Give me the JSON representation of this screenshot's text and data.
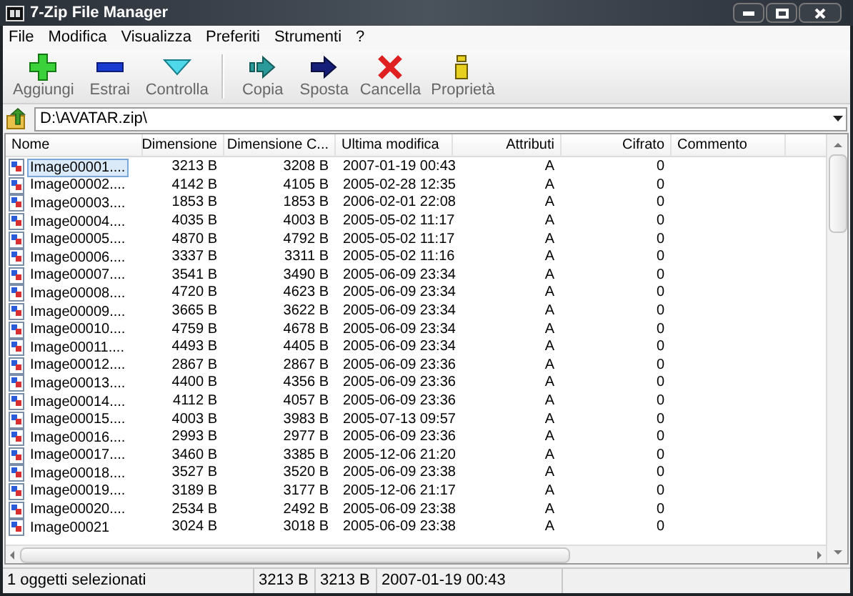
{
  "window": {
    "title": "7-Zip File Manager"
  },
  "menu": [
    "File",
    "Modifica",
    "Visualizza",
    "Preferiti",
    "Strumenti",
    "?"
  ],
  "toolbar": {
    "groups": [
      [
        {
          "label": "Aggiungi",
          "kind": "add"
        },
        {
          "label": "Estrai",
          "kind": "extract"
        },
        {
          "label": "Controlla",
          "kind": "test"
        }
      ],
      [
        {
          "label": "Copia",
          "kind": "copy"
        },
        {
          "label": "Sposta",
          "kind": "move"
        },
        {
          "label": "Cancella",
          "kind": "delete"
        },
        {
          "label": "Proprietà",
          "kind": "info"
        }
      ]
    ]
  },
  "address": {
    "value": "D:\\AVATAR.zip\\"
  },
  "table": {
    "columns": [
      "Nome",
      "Dimensione",
      "Dimensione C...",
      "Ultima modifica",
      "Attributi",
      "Cifrato",
      "Commento"
    ],
    "rows": [
      {
        "selected": true,
        "cells": [
          "Image00001....",
          "3213 B",
          "3208 B",
          "2007-01-19 00:43",
          "A",
          "0"
        ]
      },
      {
        "selected": false,
        "cells": [
          "Image00002....",
          "4142 B",
          "4105 B",
          "2005-02-28 12:35",
          "A",
          "0"
        ]
      },
      {
        "selected": false,
        "cells": [
          "Image00003....",
          "1853 B",
          "1853 B",
          "2006-02-01 22:08",
          "A",
          "0"
        ]
      },
      {
        "selected": false,
        "cells": [
          "Image00004....",
          "4035 B",
          "4003 B",
          "2005-05-02 11:17",
          "A",
          "0"
        ]
      },
      {
        "selected": false,
        "cells": [
          "Image00005....",
          "4870 B",
          "4792 B",
          "2005-05-02 11:17",
          "A",
          "0"
        ]
      },
      {
        "selected": false,
        "cells": [
          "Image00006....",
          "3337 B",
          "3311 B",
          "2005-05-02 11:16",
          "A",
          "0"
        ]
      },
      {
        "selected": false,
        "cells": [
          "Image00007....",
          "3541 B",
          "3490 B",
          "2005-06-09 23:34",
          "A",
          "0"
        ]
      },
      {
        "selected": false,
        "cells": [
          "Image00008....",
          "4720 B",
          "4623 B",
          "2005-06-09 23:34",
          "A",
          "0"
        ]
      },
      {
        "selected": false,
        "cells": [
          "Image00009....",
          "3665 B",
          "3622 B",
          "2005-06-09 23:34",
          "A",
          "0"
        ]
      },
      {
        "selected": false,
        "cells": [
          "Image00010....",
          "4759 B",
          "4678 B",
          "2005-06-09 23:34",
          "A",
          "0"
        ]
      },
      {
        "selected": false,
        "cells": [
          "Image00011....",
          "4493 B",
          "4405 B",
          "2005-06-09 23:34",
          "A",
          "0"
        ]
      },
      {
        "selected": false,
        "cells": [
          "Image00012....",
          "2867 B",
          "2867 B",
          "2005-06-09 23:36",
          "A",
          "0"
        ]
      },
      {
        "selected": false,
        "cells": [
          "Image00013....",
          "4400 B",
          "4356 B",
          "2005-06-09 23:36",
          "A",
          "0"
        ]
      },
      {
        "selected": false,
        "cells": [
          "Image00014....",
          "4112 B",
          "4057 B",
          "2005-06-09 23:36",
          "A",
          "0"
        ]
      },
      {
        "selected": false,
        "cells": [
          "Image00015....",
          "4003 B",
          "3983 B",
          "2005-07-13 09:57",
          "A",
          "0"
        ]
      },
      {
        "selected": false,
        "cells": [
          "Image00016....",
          "2993 B",
          "2977 B",
          "2005-06-09 23:36",
          "A",
          "0"
        ]
      },
      {
        "selected": false,
        "cells": [
          "Image00017....",
          "3460 B",
          "3385 B",
          "2005-12-06 21:20",
          "A",
          "0"
        ]
      },
      {
        "selected": false,
        "cells": [
          "Image00018....",
          "3527 B",
          "3520 B",
          "2005-06-09 23:38",
          "A",
          "0"
        ]
      },
      {
        "selected": false,
        "cells": [
          "Image00019....",
          "3189 B",
          "3177 B",
          "2005-12-06 21:17",
          "A",
          "0"
        ]
      },
      {
        "selected": false,
        "cells": [
          "Image00020....",
          "2534 B",
          "2492 B",
          "2005-06-09 23:38",
          "A",
          "0"
        ]
      },
      {
        "selected": false,
        "cells": [
          "Image00021",
          "3024 B",
          "3018 B",
          "2005-06-09 23:38",
          "A",
          "0"
        ]
      }
    ]
  },
  "status_bar": [
    "1 oggetti selezionati",
    "3213 B",
    "3213 B",
    "2007-01-19 00:43"
  ]
}
